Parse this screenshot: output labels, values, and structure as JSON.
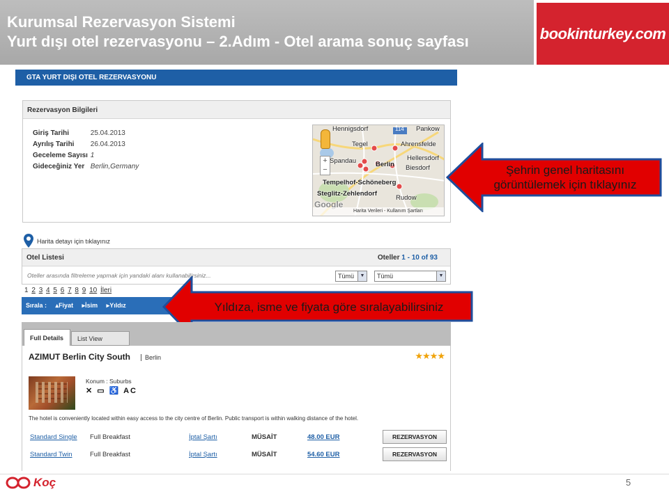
{
  "slide": {
    "title_line1": "Kurumsal Rezervasyon Sistemi",
    "title_line2": "Yurt dışı otel rezervasyonu – 2.Adım - Otel arama sonuç sayfası",
    "brand": "bookinturkey.com",
    "page_number": "5",
    "footer_logo": "Koç"
  },
  "app": {
    "section_bar": "GTA YURT DIŞI OTEL REZERVASYONU"
  },
  "reservation": {
    "heading": "Rezervasyon Bilgileri",
    "fields": [
      {
        "label": "Giriş Tarihi",
        "value": "25.04.2013"
      },
      {
        "label": "Ayrılış Tarihi",
        "value": "26.04.2013"
      },
      {
        "label": "Geceleme Sayısı",
        "value": "1"
      },
      {
        "label": "Gideceğiniz Yer",
        "value": "Berlin,Germany"
      }
    ]
  },
  "map": {
    "labels": [
      "Hennigsdorf",
      "Pankow",
      "Tegel",
      "Ahrensfelde",
      "Hellersdorf",
      "Spandau",
      "Berlin",
      "Biesdorf",
      "Tempelhof-Schöneberg",
      "Steglitz-Zehlendorf",
      "Rudow"
    ],
    "footer": "Harita Verileri - Kullanım Şartları",
    "watermark": "Google",
    "road_number": "114"
  },
  "map_detail_link": "Harita detayı için tıklayınız",
  "hotel_list": {
    "heading": "Otel Listesi",
    "count_prefix": "Oteller",
    "count_range": "1 - 10 of 93",
    "filter_placeholder": "Oteller arasında filtreleme yapmak için yandaki alanı kullanabilirsiniz...",
    "select1": "Tümü",
    "select2": "Tümü",
    "pages": [
      "1",
      "2",
      "3",
      "4",
      "5",
      "6",
      "7",
      "8",
      "9",
      "10"
    ],
    "next_label": "İleri",
    "sort_label": "Sırala :",
    "sort_options": [
      "Fiyat",
      "İsim",
      "Yıldız"
    ]
  },
  "callouts": {
    "map_hint_line1": "Şehrin genel haritasını",
    "map_hint_line2": "görüntülemek için tıklayınız",
    "sort_hint": "Yıldıza, isme ve fiyata göre sıralayabilirsiniz",
    "arrow_color": "#e10000",
    "arrow_border": "#1f4e9c"
  },
  "detail": {
    "tab_full": "Full Details",
    "tab_list": "List View",
    "hotel_name": "AZIMUT Berlin City South",
    "city": "Berlin",
    "stars": "★★★★",
    "star_rating": 4,
    "location": "Konum : Suburbs",
    "amenity_icons": [
      "restaurant-icon",
      "tv-icon",
      "wheelchair-icon",
      "ac-icon"
    ],
    "amenities_text": "✕ ▭ ♿ AC",
    "description": "The hotel is conveniently located within easy access to the city centre of Berlin. Public transport is within walking distance of the hotel.",
    "rooms": [
      {
        "type": "Standard Single",
        "meal": "Full Breakfast",
        "cancel": "İptal Şartı",
        "status": "MÜSAİT",
        "price": "48.00 EUR",
        "button": "REZERVASYON"
      },
      {
        "type": "Standard Twin",
        "meal": "Full Breakfast",
        "cancel": "İptal Şartı",
        "status": "MÜSAİT",
        "price": "54.60 EUR",
        "button": "REZERVASYON"
      }
    ]
  }
}
